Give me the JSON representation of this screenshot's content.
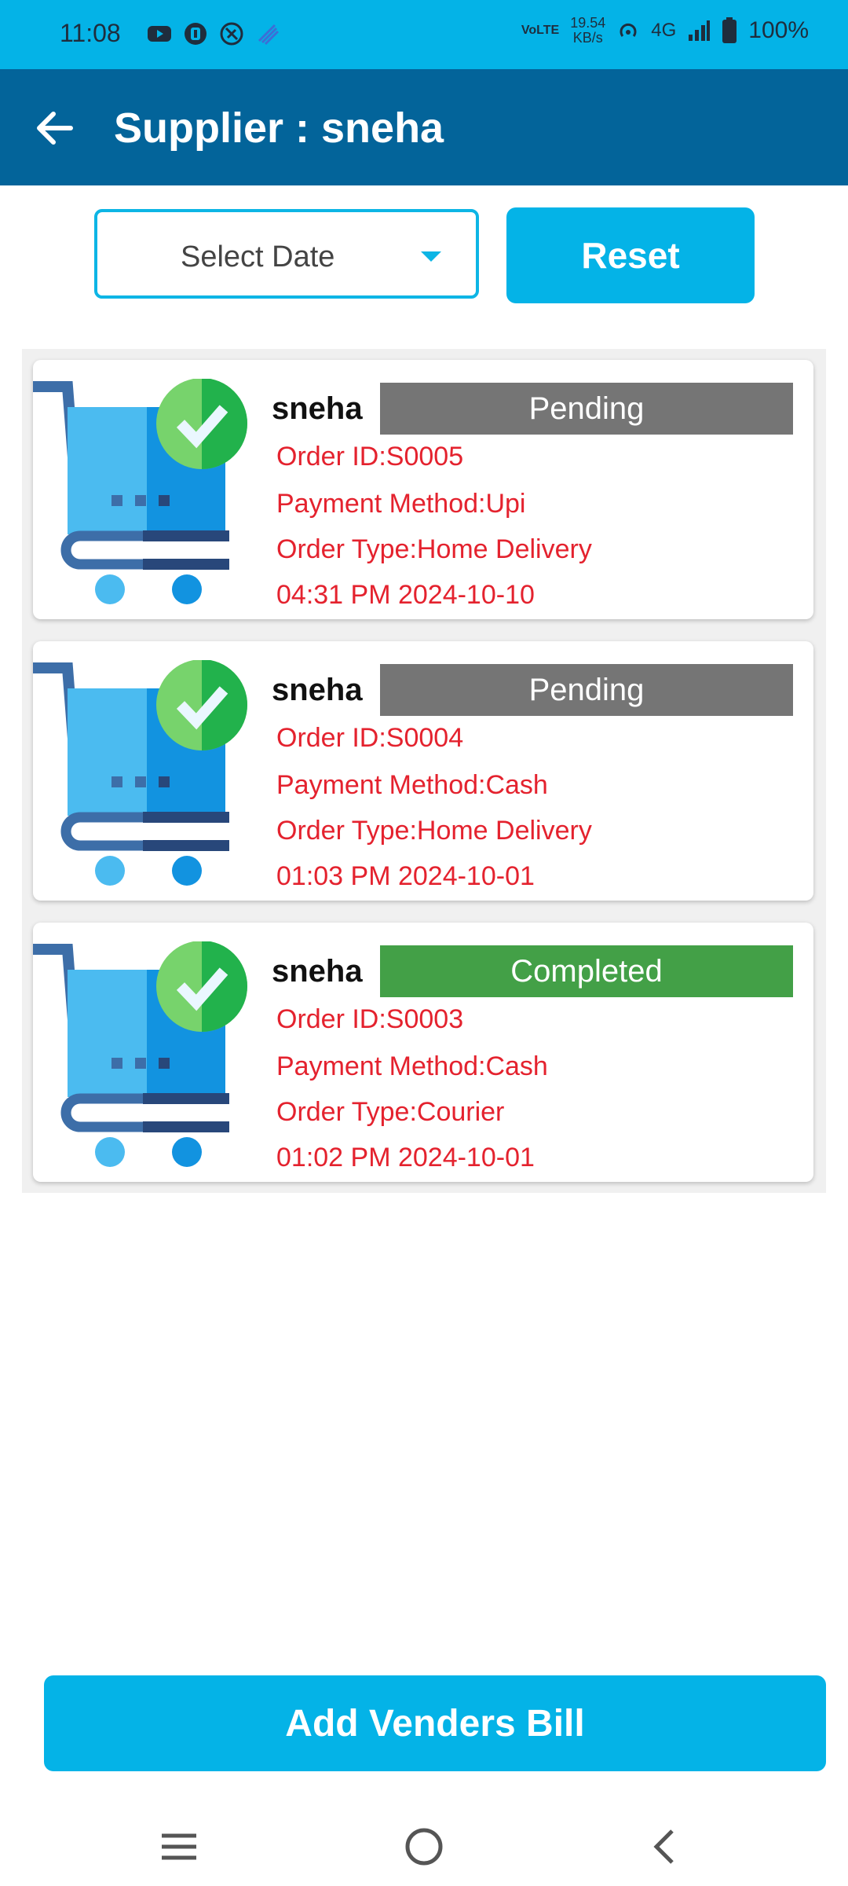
{
  "status_bar": {
    "time": "11:08",
    "network_type": "VoLTE",
    "speed_value": "19.54",
    "speed_unit": "KB/s",
    "cellular": "4G",
    "battery": "100%",
    "icons": [
      "youtube-icon",
      "app-icon",
      "shield-icon",
      "signal-waves-icon",
      "hotspot-icon",
      "signal-bars-icon",
      "battery-icon"
    ]
  },
  "app_bar": {
    "title": "Supplier : sneha",
    "back_icon": "arrow-left-icon"
  },
  "filters": {
    "date_label": "Select Date",
    "reset_label": "Reset"
  },
  "orders": [
    {
      "supplier": "sneha",
      "status": "Pending",
      "status_color": "#757575",
      "order_id": "Order ID:S0005",
      "payment": "Payment Method:Upi",
      "order_type": "Order Type:Home Delivery",
      "datetime": "04:31 PM 2024-10-10"
    },
    {
      "supplier": "sneha",
      "status": "Pending",
      "status_color": "#757575",
      "order_id": "Order ID:S0004",
      "payment": "Payment Method:Cash",
      "order_type": "Order Type:Home Delivery",
      "datetime": "01:03 PM 2024-10-01"
    },
    {
      "supplier": "sneha",
      "status": "Completed",
      "status_color": "#43a047",
      "order_id": "Order ID:S0003",
      "payment": "Payment Method:Cash",
      "order_type": "Order Type:Courier",
      "datetime": "01:02 PM 2024-10-01"
    }
  ],
  "footer": {
    "add_button": "Add Venders Bill"
  },
  "nav_bar": {
    "icons": [
      "menu-icon",
      "home-circle-icon",
      "back-chevron-icon"
    ]
  }
}
